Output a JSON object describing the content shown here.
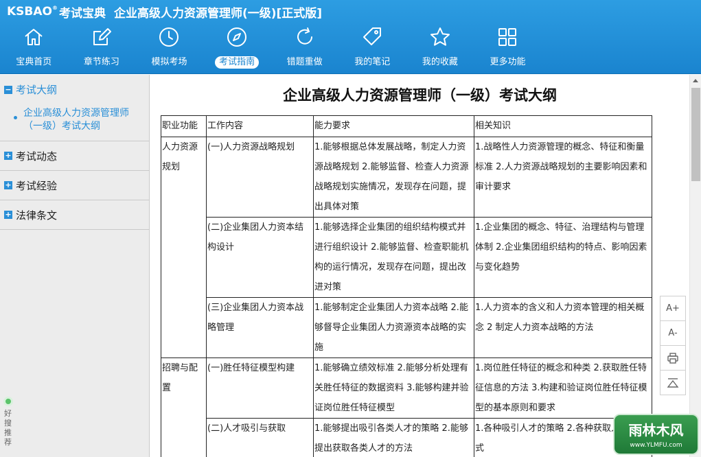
{
  "app": {
    "logo": "KSBAO",
    "logo_mark": "®",
    "logo_cn": "考试宝典",
    "title": "企业高级人力资源管理师(一级)[正式版]"
  },
  "toolbar": [
    {
      "label": "宝典首页",
      "icon": "home-icon"
    },
    {
      "label": "章节练习",
      "icon": "edit-icon"
    },
    {
      "label": "模拟考场",
      "icon": "clock-icon"
    },
    {
      "label": "考试指南",
      "icon": "compass-icon",
      "active": true
    },
    {
      "label": "错题重做",
      "icon": "refresh-icon"
    },
    {
      "label": "我的笔记",
      "icon": "tag-icon"
    },
    {
      "label": "我的收藏",
      "icon": "star-icon"
    },
    {
      "label": "更多功能",
      "icon": "grid-icon"
    }
  ],
  "sidebar": {
    "sections": [
      {
        "label": "考试大纲",
        "toggle": "−",
        "items": [
          "企业高级人力资源管理师（一级）考试大纲"
        ]
      },
      {
        "label": "考试动态",
        "toggle": "+"
      },
      {
        "label": "考试经验",
        "toggle": "+"
      },
      {
        "label": "法律条文",
        "toggle": "+"
      }
    ],
    "recommend": "好搜推荐"
  },
  "document": {
    "title": "企业高级人力资源管理师（一级）考试大纲",
    "headers": [
      "职业功能",
      "工作内容",
      "能力要求",
      "相关知识"
    ],
    "groups": [
      {
        "function": "人力资源规划",
        "rows": [
          {
            "content": "(一)人力资源战略规划",
            "ability": "1.能够根据总体发展战略，制定人力资源战略规划 2.能够监督、检查人力资源战略规划实施情况，发现存在问题，提出具体对策",
            "knowledge": "1.战略性人力资源管理的概念、特征和衡量标准 2.人力资源战略规划的主要影响因素和审计要求"
          },
          {
            "content": "(二)企业集团人力资本结构设计",
            "ability": "1.能够选择企业集团的组织结构模式并进行组织设计 2.能够监督、检查职能机构的运行情况，发现存在问题，提出改进对策",
            "knowledge": "1.企业集团的概念、特征、治理结构与管理体制 2.企业集团组织结构的特点、影响因素与变化趋势"
          },
          {
            "content": "(三)企业集团人力资本战略管理",
            "ability": "1.能够制定企业集团人力资本战略 2.能够督导企业集团人力资源资本战略的实施",
            "knowledge": "1.人力资本的含义和人力资本管理的相关概念 2 制定人力资本战略的方法"
          }
        ]
      },
      {
        "function": "招聘与配置",
        "rows": [
          {
            "content": "(一)胜任特征模型构建",
            "ability": "1.能够确立绩效标准 2.能够分析处理有关胜任特征的数据资料 3.能够构建并验证岗位胜任特征模型",
            "knowledge": "1.岗位胜任特征的概念和种类 2.获取胜任特征信息的方法 3.构建和验证岗位胜任特征模型的基本原则和要求"
          },
          {
            "content": "(二)人才吸引与获取",
            "ability": "1.能够提出吸引各类人才的策略 2.能够提出获取各类人才的方法",
            "knowledge": "1.各种吸引人才的策略 2.各种获取人才的方式"
          }
        ]
      }
    ]
  },
  "side_tools": [
    "A+",
    "A-",
    "print-icon",
    "back-to-top-icon"
  ],
  "watermark": {
    "main": "雨林木风",
    "sub": "www.YLMFU.com"
  },
  "colors": {
    "header": "#1a84cf",
    "accent": "#2a8fd7",
    "sidebar_bg": "#ececec"
  }
}
